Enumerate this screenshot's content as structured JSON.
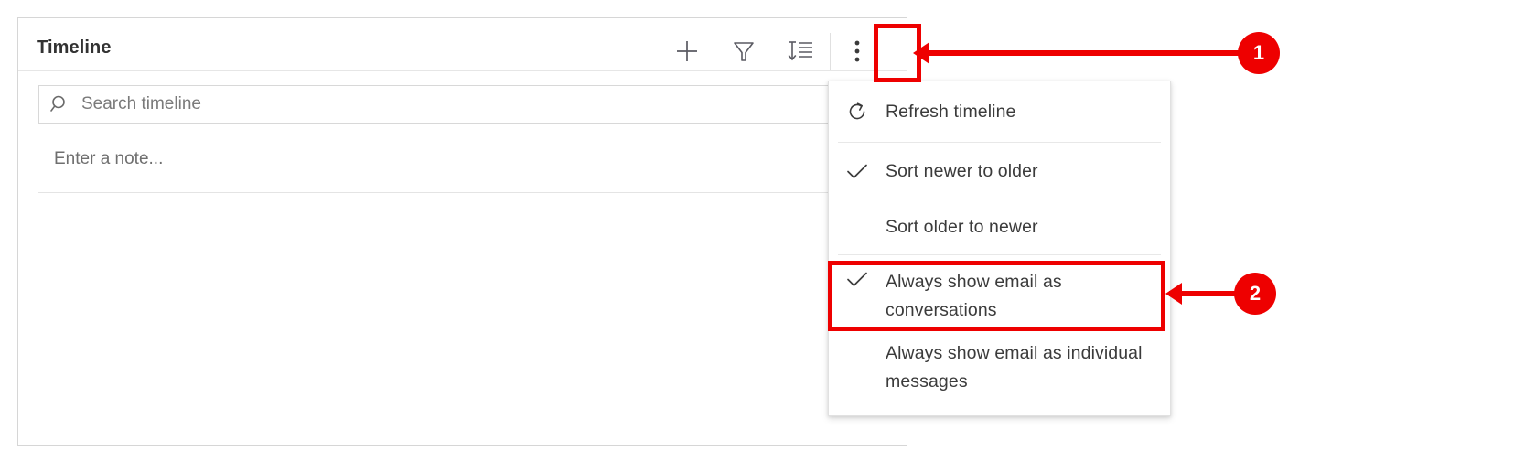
{
  "panel": {
    "title": "Timeline",
    "toolbar": [
      {
        "name": "add-record-button",
        "icon": "plus-icon",
        "tooltip": "Create a timeline record"
      },
      {
        "name": "filter-button",
        "icon": "funnel-icon",
        "tooltip": "Filter timeline"
      },
      {
        "name": "sort-button",
        "icon": "sort-descending-icon",
        "tooltip": "Sort timeline"
      },
      {
        "name": "more-commands-button",
        "icon": "more-vertical-icon",
        "tooltip": "More commands"
      }
    ],
    "search": {
      "placeholder": "Search timeline",
      "value": "",
      "icon": "search-icon"
    },
    "note": {
      "placeholder": "Enter a note...",
      "value": ""
    }
  },
  "more_menu": {
    "items": [
      {
        "label": "Refresh timeline",
        "icon": "refresh-icon",
        "checked": false
      },
      {
        "label": "Sort newer to older",
        "icon": "check-icon",
        "checked": true
      },
      {
        "label": "Sort older to newer",
        "icon": "",
        "checked": false
      },
      {
        "label": "Always show email as conversations",
        "icon": "check-icon",
        "checked": true
      },
      {
        "label": "Always show email as individual messages",
        "icon": "",
        "checked": false
      }
    ]
  },
  "annotations": {
    "accent_color": "#ee0000",
    "callouts": [
      {
        "number": "1",
        "target": "more-commands-button"
      },
      {
        "number": "2",
        "target": "always-show-email-as-conversations-menu-item"
      }
    ]
  }
}
